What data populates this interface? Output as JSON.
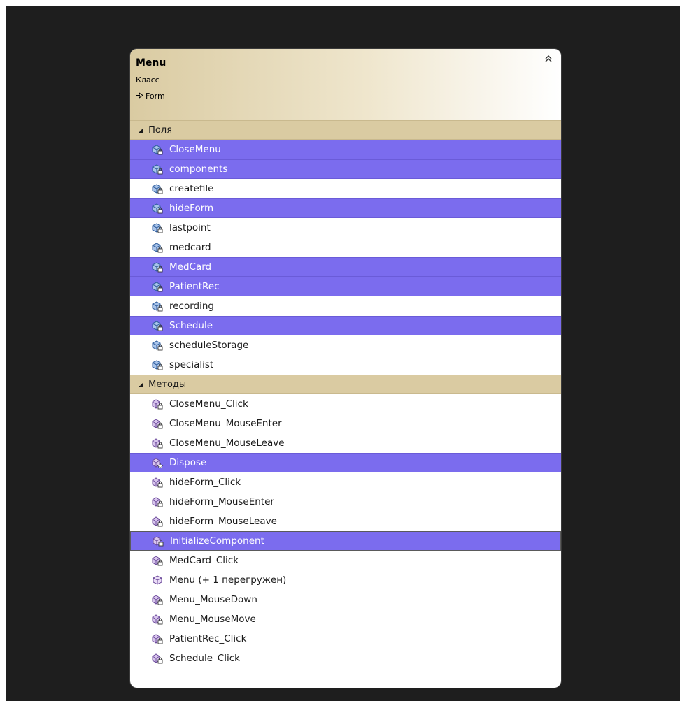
{
  "class": {
    "name": "Menu",
    "kind": "Класс",
    "base": "Form"
  },
  "sections": {
    "fields": {
      "title": "Поля",
      "items": [
        {
          "label": "CloseMenu",
          "selected": true
        },
        {
          "label": "components",
          "selected": true
        },
        {
          "label": "createfile",
          "selected": false
        },
        {
          "label": "hideForm",
          "selected": true
        },
        {
          "label": "lastpoint",
          "selected": false
        },
        {
          "label": "medcard",
          "selected": false
        },
        {
          "label": "MedCard",
          "selected": true
        },
        {
          "label": "PatientRec",
          "selected": true
        },
        {
          "label": "recording",
          "selected": false
        },
        {
          "label": "Schedule",
          "selected": true
        },
        {
          "label": "scheduleStorage",
          "selected": false
        },
        {
          "label": "specialist",
          "selected": false
        }
      ]
    },
    "methods": {
      "title": "Методы",
      "items": [
        {
          "label": "CloseMenu_Click",
          "selected": false,
          "icon": "private-method-icon"
        },
        {
          "label": "CloseMenu_MouseEnter",
          "selected": false,
          "icon": "private-method-icon"
        },
        {
          "label": "CloseMenu_MouseLeave",
          "selected": false,
          "icon": "private-method-icon"
        },
        {
          "label": "Dispose",
          "selected": true,
          "icon": "protected-method-icon"
        },
        {
          "label": "hideForm_Click",
          "selected": false,
          "icon": "private-method-icon"
        },
        {
          "label": "hideForm_MouseEnter",
          "selected": false,
          "icon": "private-method-icon"
        },
        {
          "label": "hideForm_MouseLeave",
          "selected": false,
          "icon": "private-method-icon"
        },
        {
          "label": "InitializeComponent",
          "selected": true,
          "focused": true,
          "icon": "private-method-icon"
        },
        {
          "label": "MedCard_Click",
          "selected": false,
          "icon": "private-method-icon"
        },
        {
          "label": "Menu (+ 1 перегружен)",
          "selected": false,
          "icon": "public-method-icon"
        },
        {
          "label": "Menu_MouseDown",
          "selected": false,
          "icon": "private-method-icon"
        },
        {
          "label": "Menu_MouseMove",
          "selected": false,
          "icon": "private-method-icon"
        },
        {
          "label": "PatientRec_Click",
          "selected": false,
          "icon": "private-method-icon"
        },
        {
          "label": "Schedule_Click",
          "selected": false,
          "icon": "private-method-icon"
        }
      ]
    }
  },
  "colors": {
    "selection": "#7b6cee",
    "section": "#dacba2",
    "background": "#1e1e1e"
  }
}
